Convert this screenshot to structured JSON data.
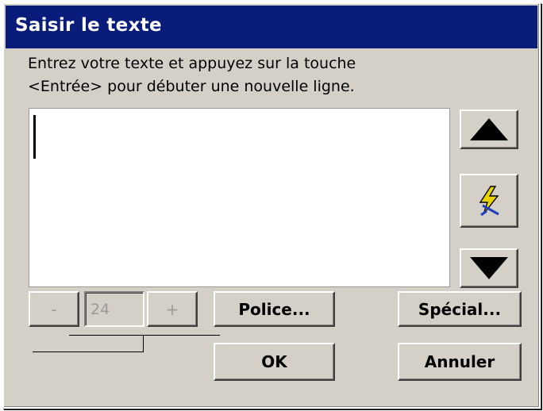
{
  "dialog": {
    "title": "Saisir le texte",
    "instruction_line1": "Entrez votre texte et appuyez sur la touche",
    "instruction_line2": "<Entrée> pour débuter une nouvelle ligne.",
    "text_value": ""
  },
  "font_size": {
    "minus_label": "-",
    "value": "24",
    "plus_label": "+"
  },
  "buttons": {
    "font_label": "Police...",
    "special_label": "Spécial...",
    "ok_label": "OK",
    "cancel_label": "Annuler"
  },
  "icons": {
    "scroll_up": "up-triangle-icon",
    "special_action": "lightning-icon",
    "scroll_down": "down-triangle-icon"
  },
  "colors": {
    "titlebar": "#0a1c7a",
    "window": "#d4d0c8"
  }
}
